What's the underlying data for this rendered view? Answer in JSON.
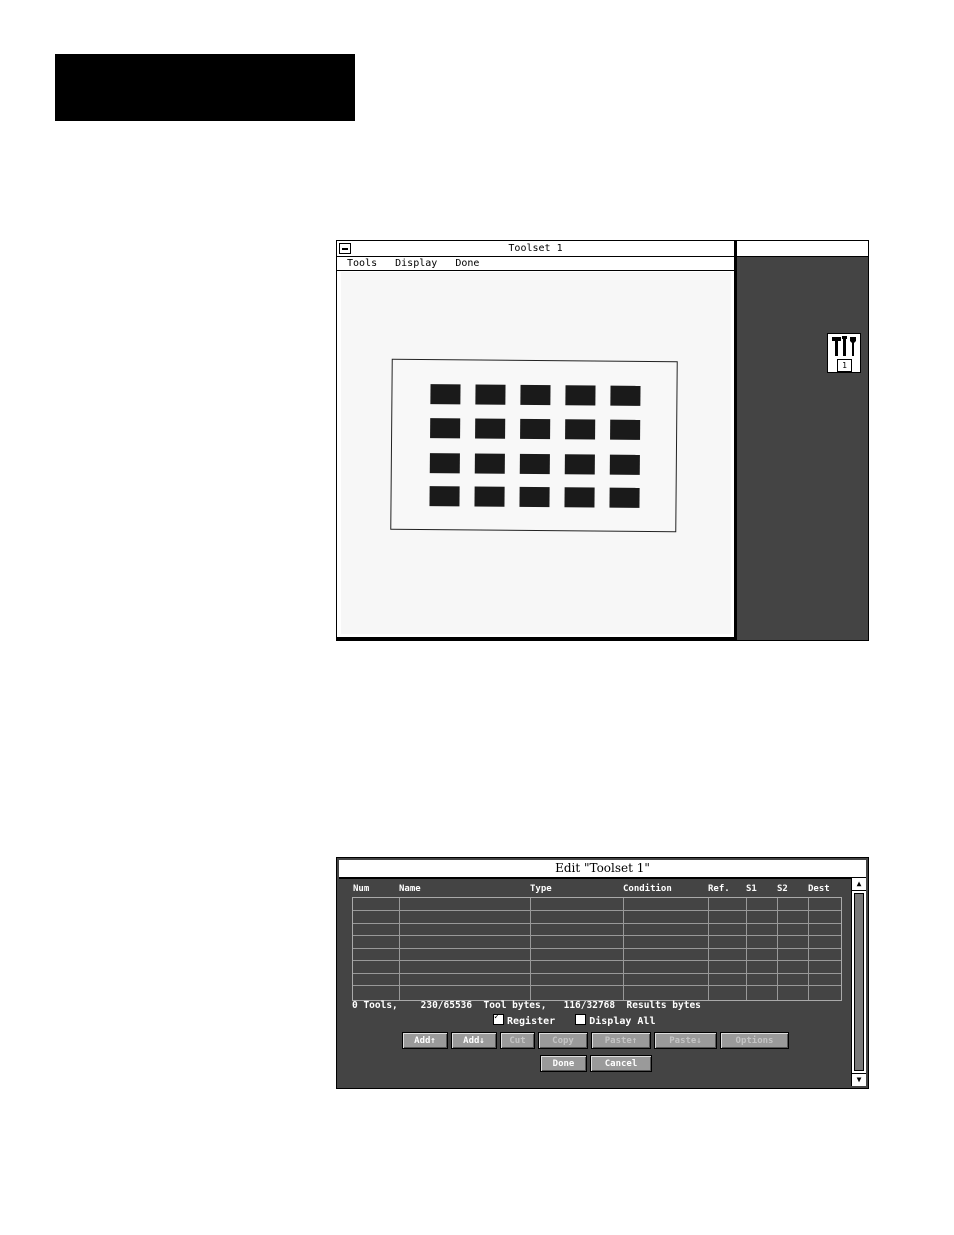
{
  "toolset_window": {
    "title": "Toolset 1",
    "menu": [
      "Tools",
      "Display",
      "Done"
    ],
    "icon_number": "1"
  },
  "edit_dialog": {
    "title": "Edit \"Toolset 1\"",
    "columns": [
      "Num",
      "Name",
      "Type",
      "Condition",
      "Ref.",
      "S1",
      "S2",
      "Dest"
    ],
    "stats": "0 Tools,    230/65536  Tool bytes,   116/32768  Results bytes",
    "register_label": "Register",
    "register_checked": true,
    "display_all_label": "Display All",
    "display_all_checked": false,
    "buttons": {
      "add_up": "Add↑",
      "add_down": "Add↓",
      "cut": "Cut",
      "copy": "Copy",
      "paste_up": "Paste↑",
      "paste_down": "Paste↓",
      "options": "Options",
      "done": "Done",
      "cancel": "Cancel"
    }
  }
}
